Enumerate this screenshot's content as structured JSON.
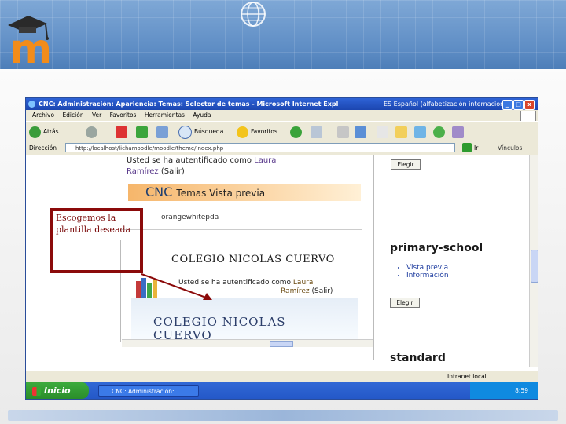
{
  "slide": {
    "logo_letter": "m",
    "callout_text": "Escogemos la plantilla deseada"
  },
  "window": {
    "title": "CNC: Administración: Apariencia: Temas: Selector de temas - Microsoft Internet Expl",
    "language": "ES Español (alfabetización internacional)",
    "menu": [
      "Archivo",
      "Edición",
      "Ver",
      "Favoritos",
      "Herramientas",
      "Ayuda"
    ],
    "toolbar": {
      "back_label": "Atrás",
      "search_label": "Búsqueda",
      "favorites_label": "Favoritos"
    },
    "address": {
      "label": "Dirección",
      "url": "http://localhost/lichamoodle/moodle/theme/index.php",
      "go_label": "Ir",
      "links_label": "Vínculos"
    },
    "status": {
      "zone_label": "Intranet local"
    },
    "taskbar": {
      "start_label": "Inicio",
      "task_label": "CNC: Administración: ...",
      "clock": "8:59"
    }
  },
  "page": {
    "user_line1": "Usted se ha autentificado como",
    "user_name": "Laura",
    "user_line2": "Ramírez",
    "logout": "(Salir)",
    "cnc_title": "CNC",
    "cnc_tail": "Temas",
    "cnc_tail2": "Vista previa",
    "theme_name": "orangewhitepda",
    "choose_label": "Elegir",
    "school_name": "COLEGIO NICOLAS CUERVO",
    "auth_line": "Usted se ha autentificado como",
    "auth_name": "Laura",
    "auth_line2": "Ramírez",
    "auth_logout": "(Salir)",
    "school_name_large_1": "COLEGIO NICOLAS",
    "school_name_large_2": "CUERVO",
    "primary_school": "primary-school",
    "primary_links": [
      "Vista previa",
      "Información"
    ],
    "standard": "standard"
  },
  "colors": {
    "callout_border": "#8b0a0a",
    "title_bar": "#1c46b0",
    "banner": "#5d8cc4"
  }
}
